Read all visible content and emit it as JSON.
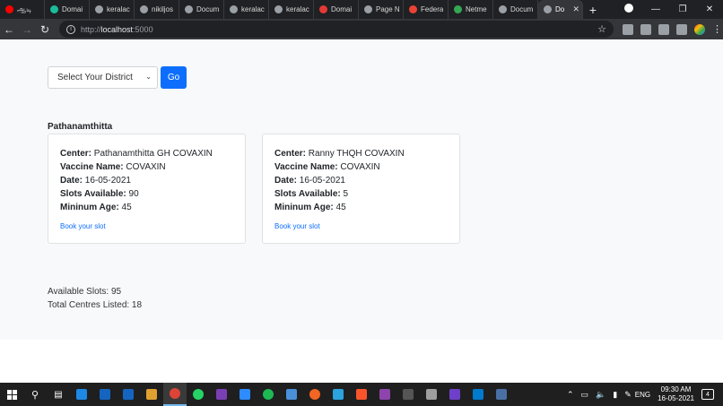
{
  "browser": {
    "tabs": [
      {
        "label": "ஆடி",
        "color": "#ff0000"
      },
      {
        "label": "Domai",
        "color": "#1abc9c"
      },
      {
        "label": "keralac",
        "color": "#9aa0a6"
      },
      {
        "label": "nikiljos",
        "color": "#9aa0a6"
      },
      {
        "label": "Docum",
        "color": "#9aa0a6"
      },
      {
        "label": "keralac",
        "color": "#9aa0a6"
      },
      {
        "label": "keralac",
        "color": "#9aa0a6"
      },
      {
        "label": "Domai",
        "color": "#e53935"
      },
      {
        "label": "Page N",
        "color": "#9aa0a6"
      },
      {
        "label": "Federa",
        "color": "#ea4335"
      },
      {
        "label": "Netme",
        "color": "#34a853"
      },
      {
        "label": "Docum",
        "color": "#9aa0a6"
      },
      {
        "label": "Do",
        "color": "#9aa0a6"
      }
    ],
    "new_tab": "+",
    "url_scheme": "http://",
    "url_host": "localhost",
    "url_port": ":5000"
  },
  "page": {
    "district_select": "Select Your District",
    "go_label": "Go",
    "district_name": "Pathanamthitta",
    "centers": [
      {
        "center_label": "Center:",
        "center": "Pathanamthitta GH COVAXIN",
        "vaccine_label": "Vaccine Name:",
        "vaccine": "COVAXIN",
        "date_label": "Date:",
        "date": "16-05-2021",
        "slots_label": "Slots Available:",
        "slots": "90",
        "age_label": "Mininum Age:",
        "age": "45",
        "book": "Book your slot"
      },
      {
        "center_label": "Center:",
        "center": "Ranny THQH COVAXIN",
        "vaccine_label": "Vaccine Name:",
        "vaccine": "COVAXIN",
        "date_label": "Date:",
        "date": "16-05-2021",
        "slots_label": "Slots Available:",
        "slots": "5",
        "age_label": "Mininum Age:",
        "age": "45",
        "book": "Book your slot"
      }
    ],
    "available_slots": "Available Slots: 95",
    "total_centres": "Total Centres Listed: 18"
  },
  "taskbar": {
    "apps": [
      "#1e88e5",
      "#1565c0",
      "#1565c0",
      "#e0a030",
      "#db4437",
      "#25d366",
      "#7b3fb5",
      "#2d8cff",
      "#1db954",
      "#4a90d9",
      "#f26522",
      "#2aa3de",
      "#fb542b",
      "#8e44ad",
      "#555555",
      "#9e9e9e",
      "#6e40c9",
      "#007acc",
      "#4a6fa5"
    ],
    "lang": "ENG",
    "time": "09:30 AM",
    "date": "16-05-2021",
    "notifications": "4"
  }
}
